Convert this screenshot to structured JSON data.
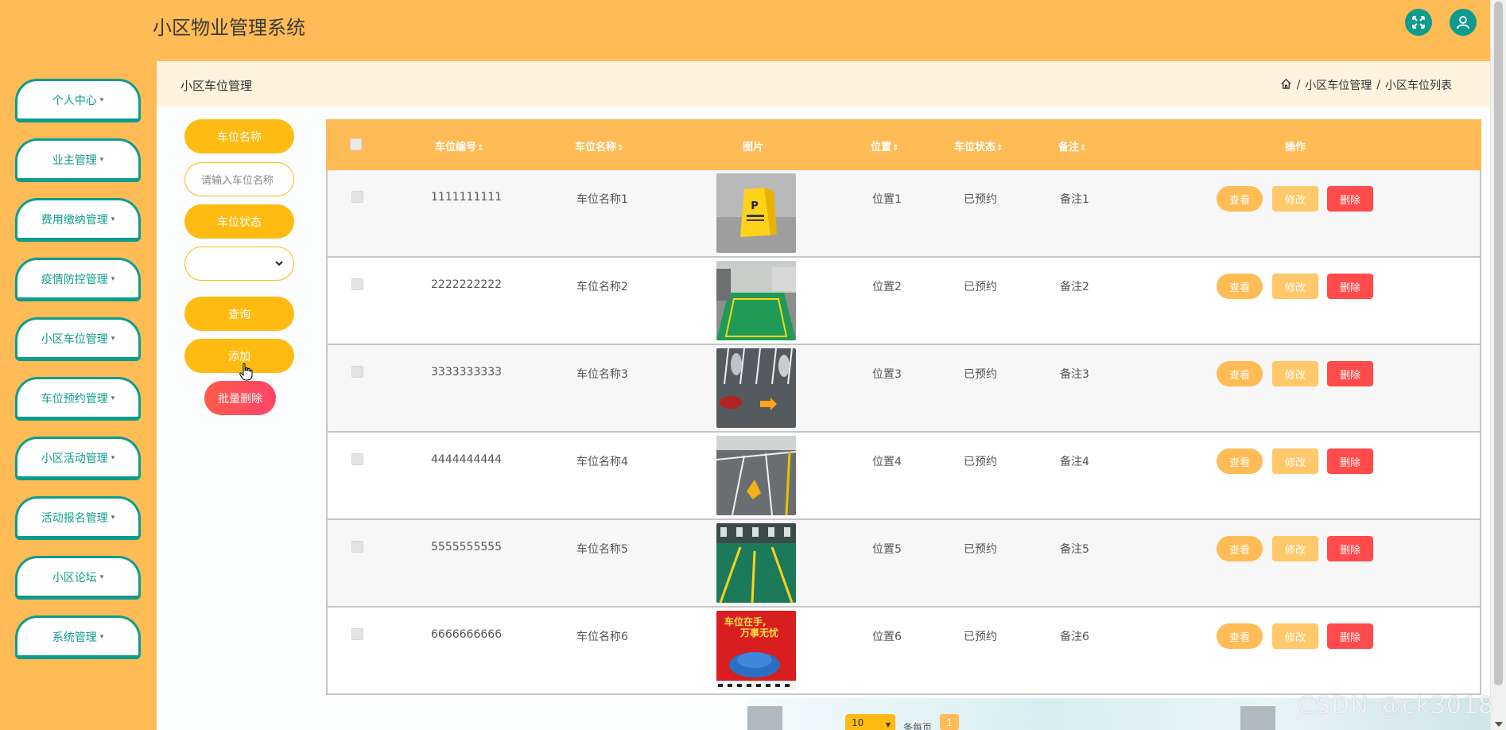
{
  "header": {
    "app_title": "小区物业管理系统",
    "icons": [
      "fullscreen-icon",
      "user-icon"
    ]
  },
  "sidebar": {
    "items": [
      {
        "label": "个人中心"
      },
      {
        "label": "业主管理"
      },
      {
        "label": "费用缴纳管理"
      },
      {
        "label": "疫情防控管理"
      },
      {
        "label": "小区车位管理"
      },
      {
        "label": "车位预约管理"
      },
      {
        "label": "小区活动管理"
      },
      {
        "label": "活动报名管理"
      },
      {
        "label": "小区论坛"
      },
      {
        "label": "系统管理"
      }
    ],
    "caret": "▾"
  },
  "breadcrumb": {
    "section_title": "小区车位管理",
    "crumbs": [
      "小区车位管理",
      "小区车位列表"
    ],
    "separator": "/"
  },
  "search": {
    "name_label": "车位名称",
    "name_placeholder": "请输入车位名称",
    "status_label": "车位状态",
    "status_value": "",
    "query_button": "查询",
    "add_button": "添加",
    "batch_delete_button": "批量删除"
  },
  "table": {
    "columns": {
      "code": "车位编号",
      "name": "车位名称",
      "image": "图片",
      "location": "位置",
      "status": "车位状态",
      "note": "备注",
      "actions": "操作"
    },
    "sort_icon": "⇕",
    "rows": [
      {
        "code": "1111111111",
        "name": "车位名称1",
        "location": "位置1",
        "status": "已预约",
        "note": "备注1",
        "image": "parking-sign-photo"
      },
      {
        "code": "2222222222",
        "name": "车位名称2",
        "location": "位置2",
        "status": "已预约",
        "note": "备注2",
        "image": "green-parking-spot-photo"
      },
      {
        "code": "3333333333",
        "name": "车位名称3",
        "location": "位置3",
        "status": "已预约",
        "note": "备注3",
        "image": "parking-lot-aerial-photo"
      },
      {
        "code": "4444444444",
        "name": "车位名称4",
        "location": "位置4",
        "status": "已预约",
        "note": "备注4",
        "image": "parking-lock-photo"
      },
      {
        "code": "5555555555",
        "name": "车位名称5",
        "location": "位置5",
        "status": "已预约",
        "note": "备注5",
        "image": "garage-green-floor-photo"
      },
      {
        "code": "6666666666",
        "name": "车位名称6",
        "location": "位置6",
        "status": "已预约",
        "note": "备注6",
        "image": "parking-ad-poster"
      }
    ],
    "action_labels": {
      "view": "查看",
      "edit": "修改",
      "delete": "删除"
    },
    "poster_text": [
      "车位在手,",
      "万事无忧"
    ]
  },
  "pagination": {
    "page_size": "10",
    "per_page_label": "条每页",
    "current_page": "1"
  },
  "watermark": "CSDN @ck3018",
  "colors": {
    "primary": "#ffbb55",
    "accent": "#0f9c8d",
    "danger": "#ff4b4b",
    "button_yellow": "#ffbb11"
  }
}
